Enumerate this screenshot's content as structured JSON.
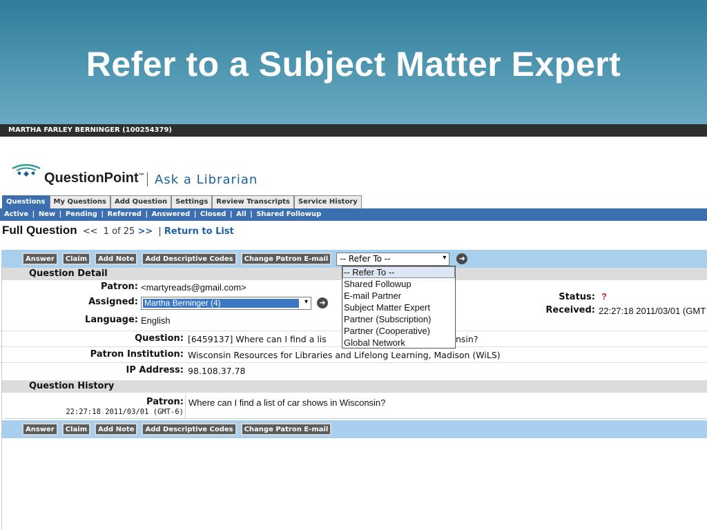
{
  "slide": {
    "title": "Refer to a Subject Matter Expert"
  },
  "user_bar": {
    "text": "MARTHA FARLEY BERNINGER (100254379)"
  },
  "logo": {
    "name": "QuestionPoint",
    "tm": "™",
    "tagline": "Ask a Librarian"
  },
  "tabs": [
    {
      "label": "Questions",
      "active": true
    },
    {
      "label": "My Questions"
    },
    {
      "label": "Add Question"
    },
    {
      "label": "Settings"
    },
    {
      "label": "Review Transcripts"
    },
    {
      "label": "Service History"
    }
  ],
  "subnav": [
    "Active",
    "New",
    "Pending",
    "Referred",
    "Answered",
    "Closed",
    "All",
    "Shared Followup"
  ],
  "full_question": {
    "title": "Full Question",
    "prev": "<<",
    "position": "1 of 25",
    "next": ">>",
    "sep": "|",
    "return_link": "Return to List"
  },
  "toolbar": {
    "buttons": [
      "Answer",
      "Claim",
      "Add Note",
      "Add Descriptive Codes",
      "Change Patron E-mail"
    ],
    "refer_select": "-- Refer To --",
    "arrow": "▾"
  },
  "question_detail": {
    "heading": "Question Detail",
    "patron_label": "Patron:",
    "patron_value": "<martyreads@gmail.com>",
    "assigned_label": "Assigned:",
    "assigned_value": "Martha Berninger (4)",
    "language_label": "Language:",
    "language_value": "English",
    "status_label": "Status:",
    "status_value": "?",
    "received_label": "Received:",
    "received_value": "22:27:18 2011/03/01 (GMT",
    "question_label": "Question:",
    "question_value_start": "[6459137] Where can I find a lis",
    "question_value_end": "nsin?",
    "institution_label": "Patron Institution:",
    "institution_value": "Wisconsin Resources for Libraries and Lifelong Learning, Madison (WiLS)",
    "ip_label": "IP Address:",
    "ip_value": "98.108.37.78"
  },
  "dropdown": {
    "options": [
      "-- Refer To --",
      "Shared Followup",
      "E-mail Partner",
      "Subject Matter Expert",
      "Partner (Subscription)",
      "Partner (Cooperative)",
      "Global Network"
    ]
  },
  "question_history": {
    "heading": "Question History",
    "patron_label": "Patron:",
    "timestamp": "22:27:18 2011/03/01 (GMT-6)",
    "message": "Where can I find a list of car shows in Wisconsin?"
  },
  "icons": {
    "go": "arrow-right-circle-icon",
    "logo": "questionpoint-logo-icon"
  },
  "colors": {
    "accent": "#3c6fb0",
    "toolbar": "#a8d0ee",
    "status": "#d21e1e"
  }
}
